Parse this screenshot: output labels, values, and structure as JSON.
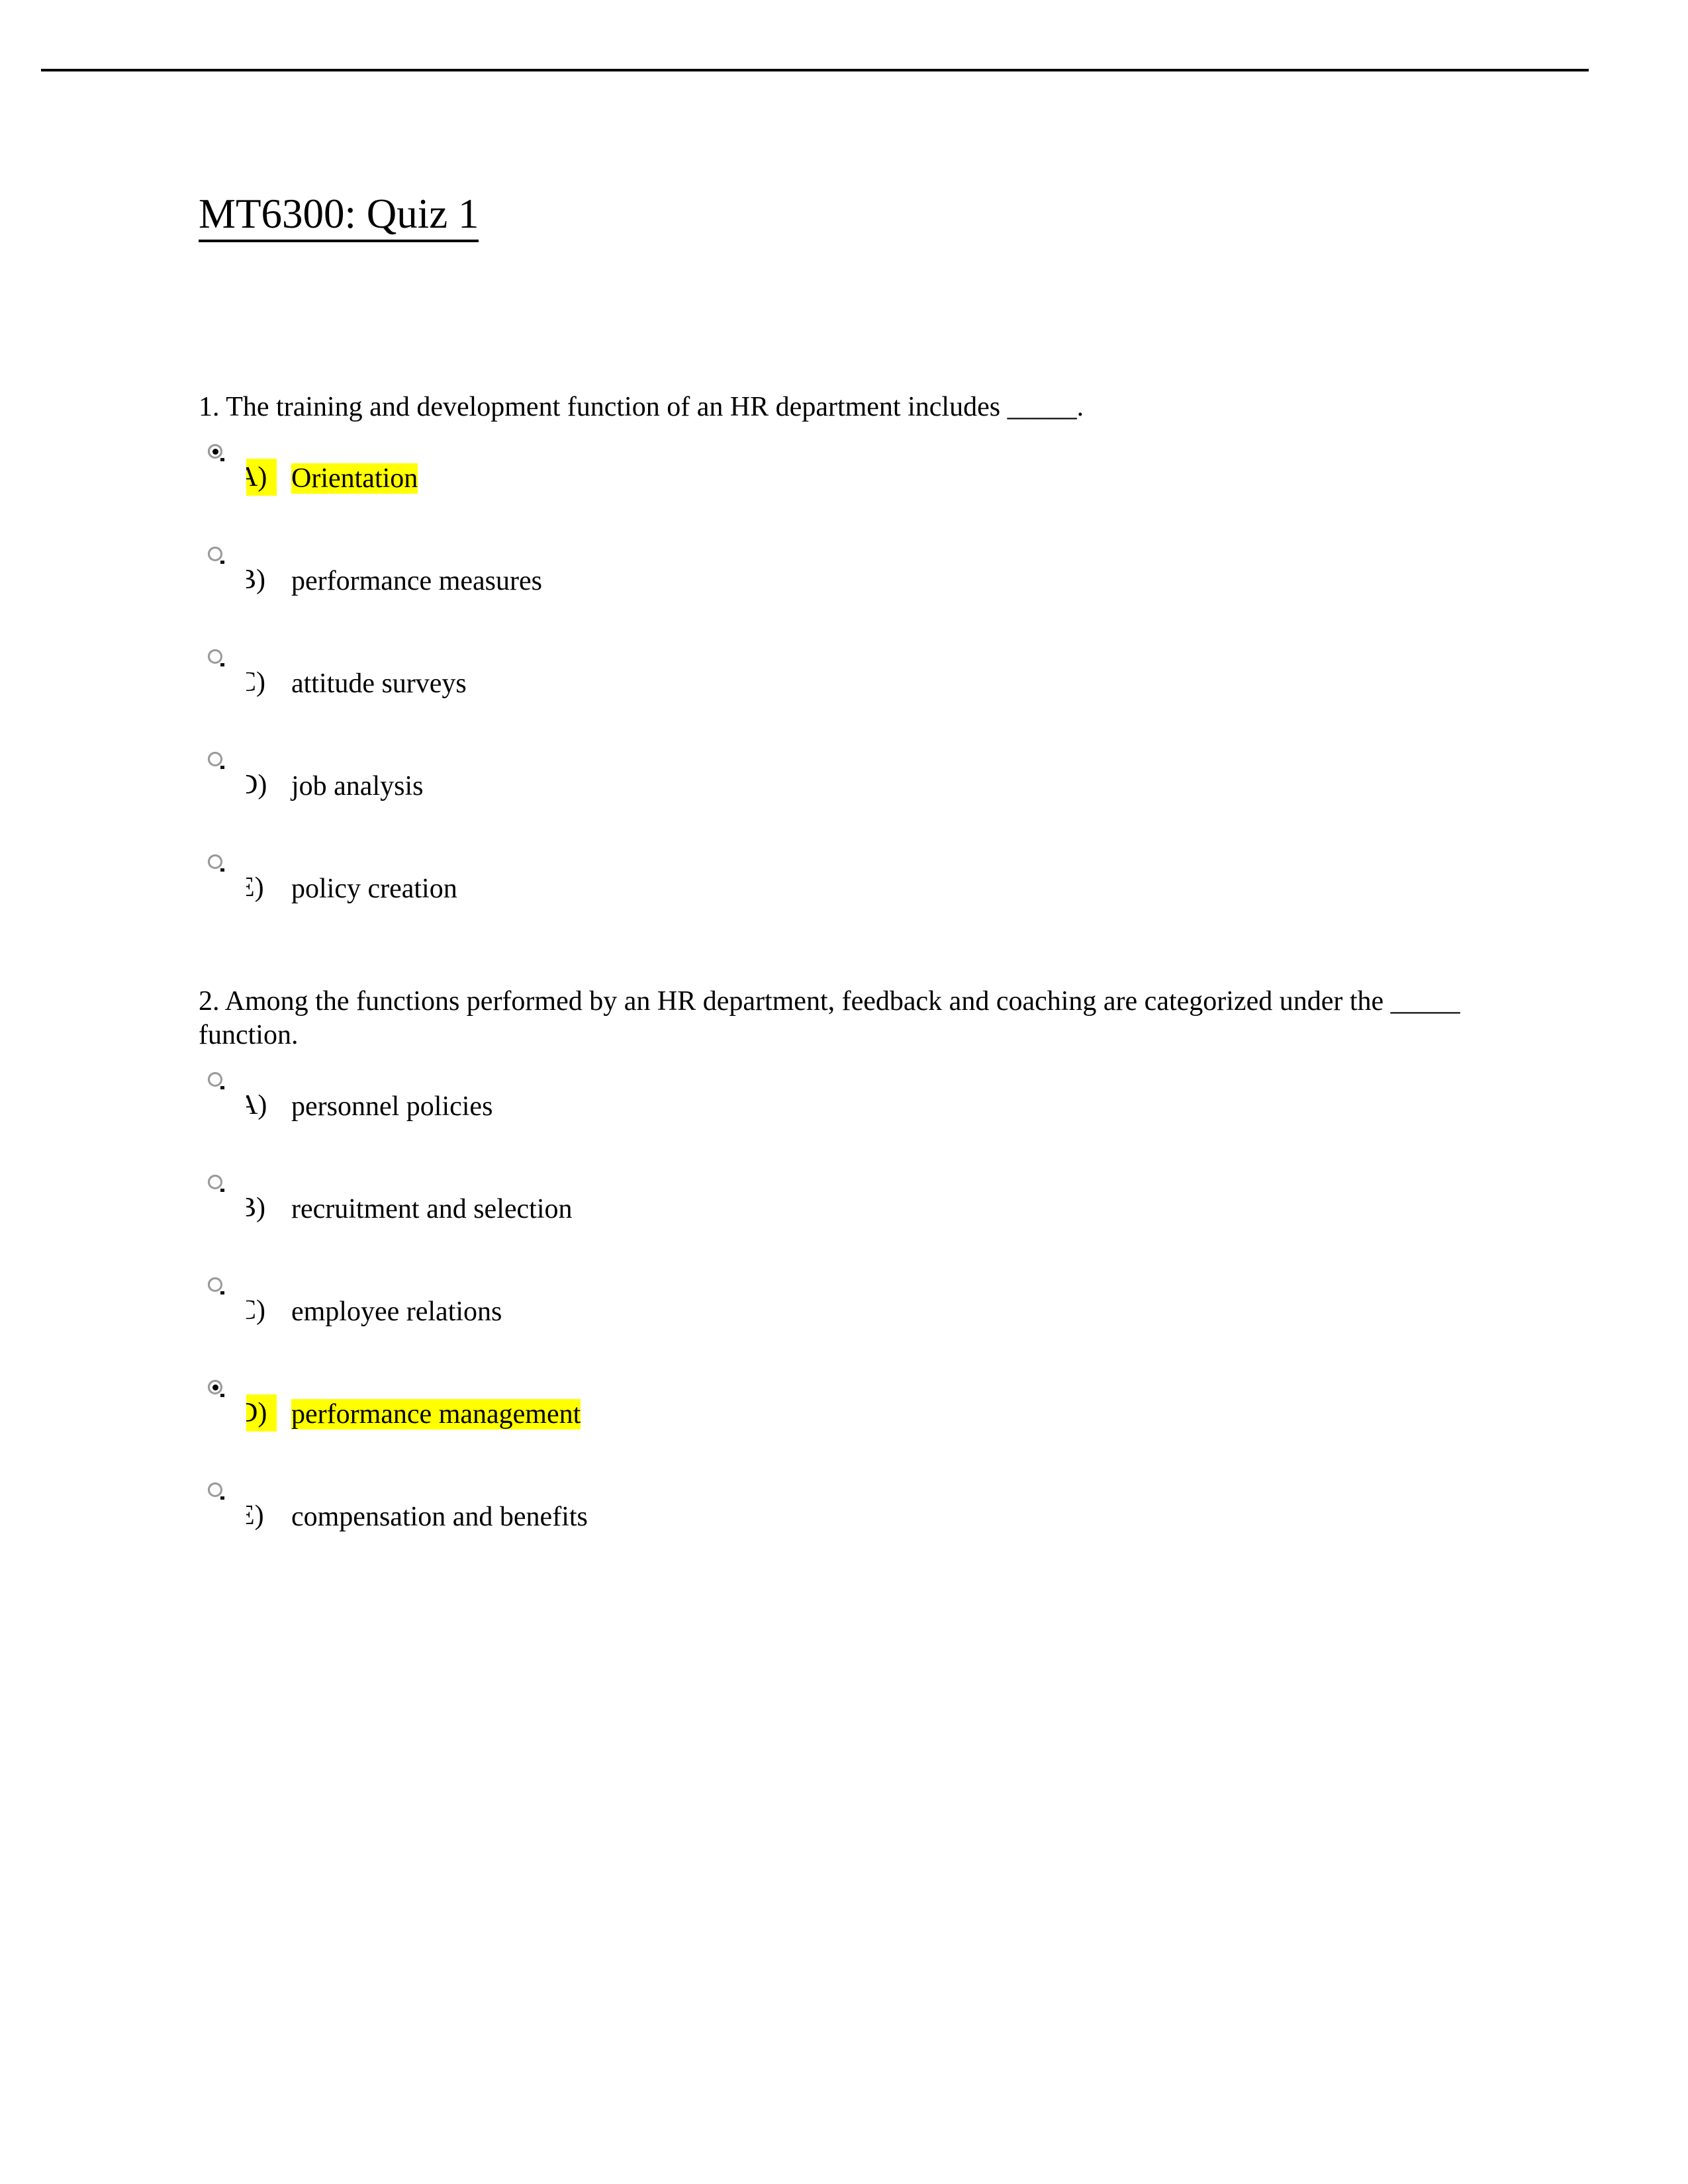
{
  "document": {
    "title": "MT6300: Quiz 1",
    "highlight_color": "#ffff00",
    "text_color": "#000000",
    "background_color": "#ffffff"
  },
  "questions": [
    {
      "number": "1.",
      "text": "1. The training and development function of an HR department includes _____.",
      "options": [
        {
          "letter": "A)",
          "text": "Orientation",
          "selected": true,
          "highlighted": true
        },
        {
          "letter": "B)",
          "text": "performance measures",
          "selected": false,
          "highlighted": false
        },
        {
          "letter": "C)",
          "text": "attitude surveys",
          "selected": false,
          "highlighted": false
        },
        {
          "letter": "D)",
          "text": "job analysis",
          "selected": false,
          "highlighted": false
        },
        {
          "letter": "E)",
          "text": "policy creation",
          "selected": false,
          "highlighted": false
        }
      ]
    },
    {
      "number": "2.",
      "text": "2. Among the functions performed by an HR department, feedback and coaching are categorized under the _____ function.",
      "options": [
        {
          "letter": "A)",
          "text": "personnel policies",
          "selected": false,
          "highlighted": false
        },
        {
          "letter": "B)",
          "text": "recruitment and selection",
          "selected": false,
          "highlighted": false
        },
        {
          "letter": "C)",
          "text": "employee relations",
          "selected": false,
          "highlighted": false
        },
        {
          "letter": "D)",
          "text": "performance management",
          "selected": true,
          "highlighted": true
        },
        {
          "letter": "E)",
          "text": "compensation and benefits",
          "selected": false,
          "highlighted": false
        }
      ]
    }
  ]
}
